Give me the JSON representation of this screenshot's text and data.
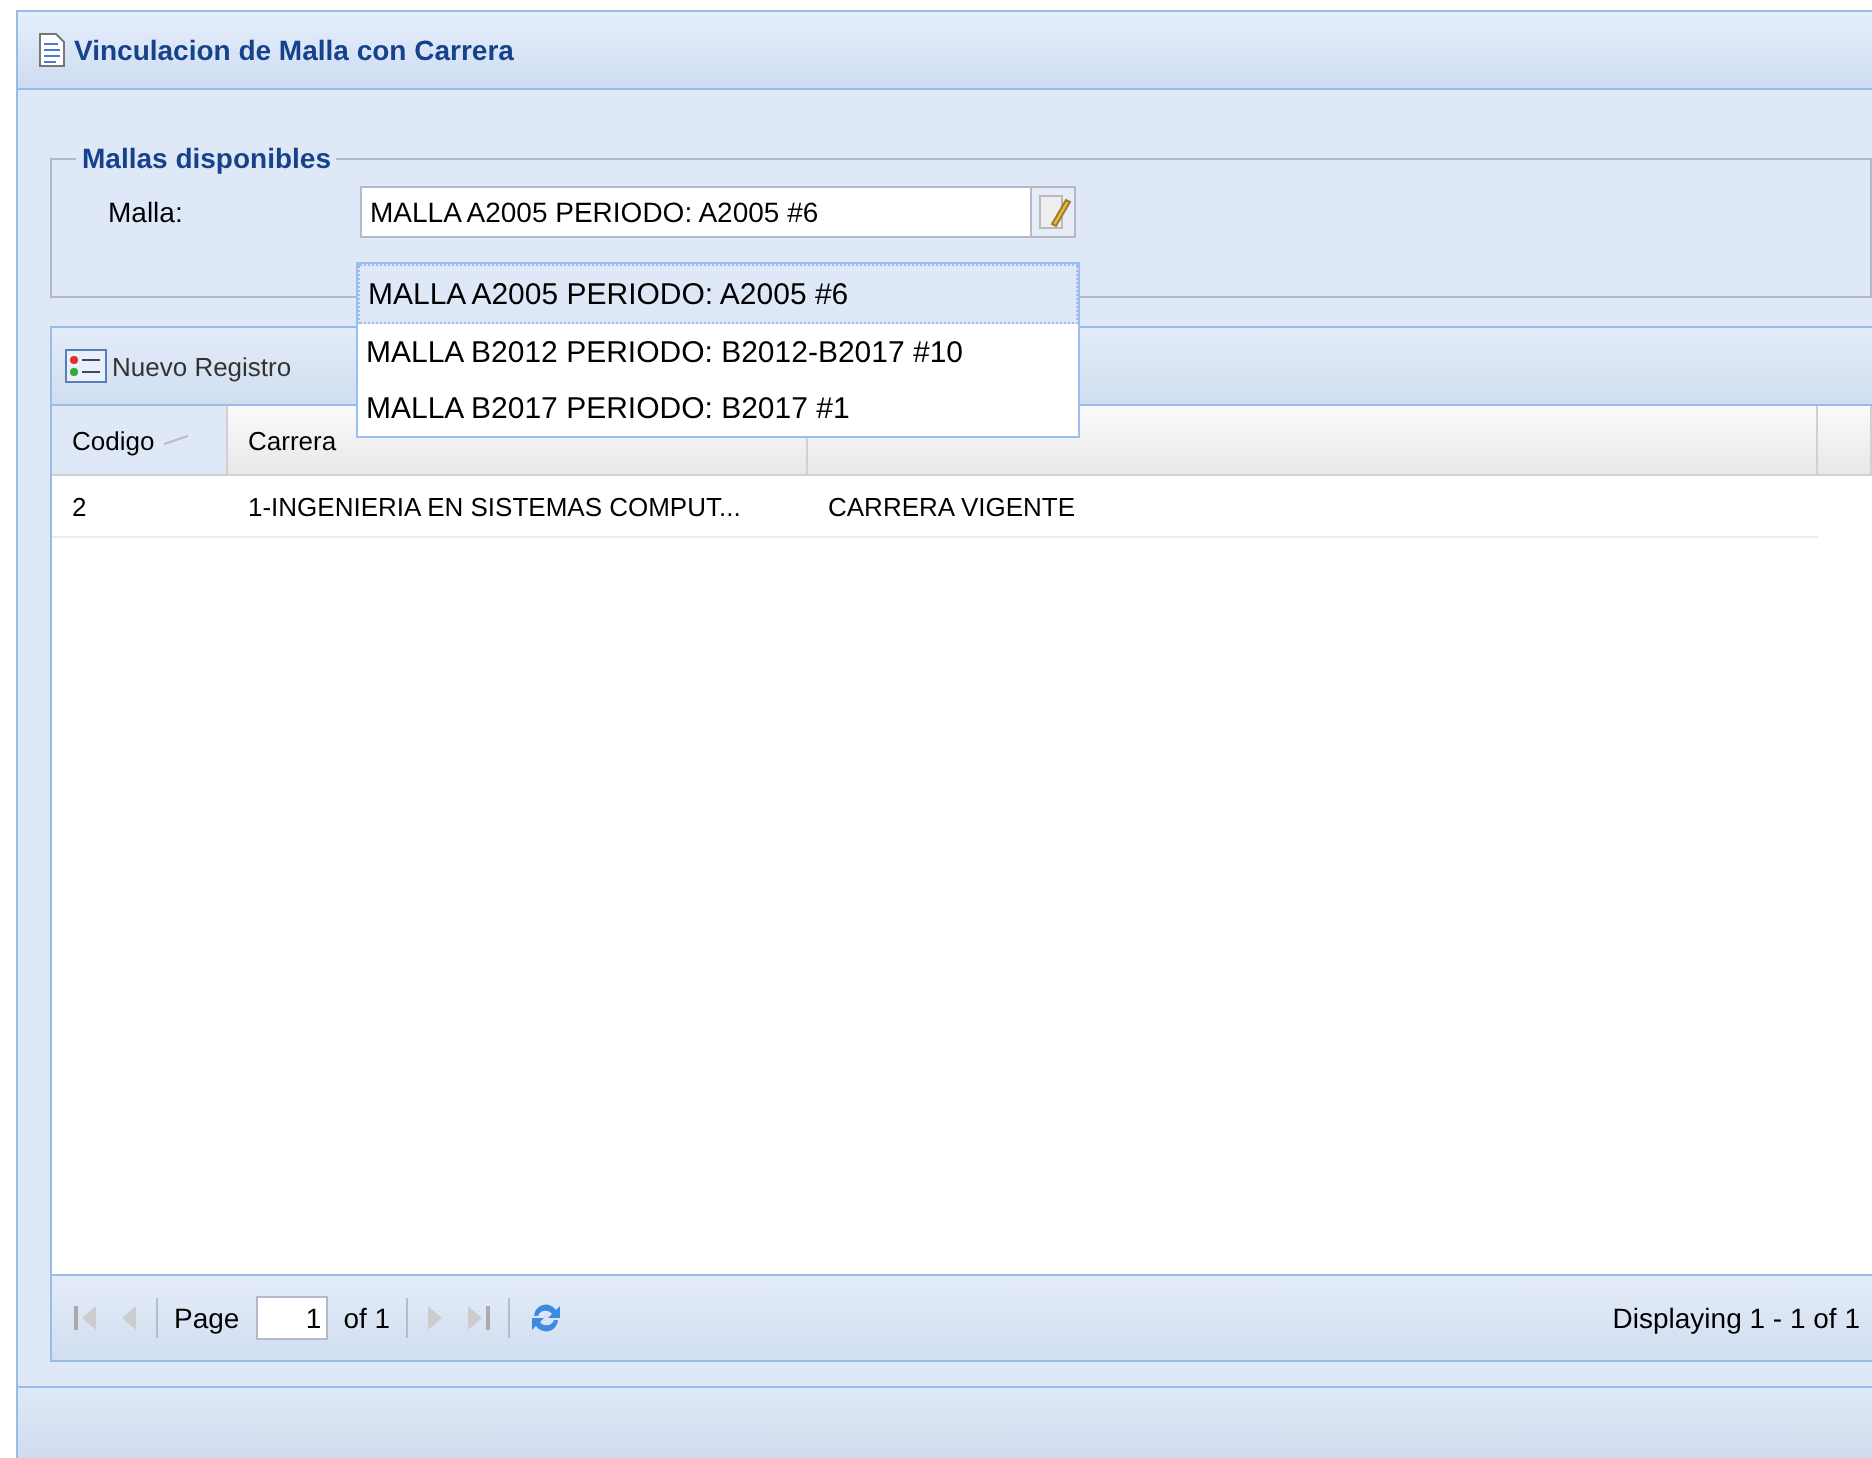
{
  "window": {
    "title": "Vinculacion de Malla con Carrera"
  },
  "fieldset": {
    "legend": "Mallas disponibles",
    "label": "Malla:",
    "value": "MALLA A2005 PERIODO: A2005 #6"
  },
  "dropdown": [
    {
      "text": "MALLA A2005 PERIODO: A2005 #6",
      "selected": true
    },
    {
      "text": "MALLA B2012 PERIODO: B2012-B2017 #10",
      "selected": false
    },
    {
      "text": "MALLA B2017 PERIODO: B2017 #1",
      "selected": false
    }
  ],
  "toolbar": {
    "button": "Nuevo Registro"
  },
  "table": {
    "columns": [
      "Codigo",
      "Carrera"
    ],
    "rows": [
      [
        "2",
        "1-INGENIERIA EN SISTEMAS COMPUT...",
        "CARRERA VIGENTE"
      ]
    ]
  },
  "pager": {
    "page_label": "Page",
    "page": "1",
    "of": "of 1",
    "display": "Displaying 1 - 1 of 1"
  }
}
